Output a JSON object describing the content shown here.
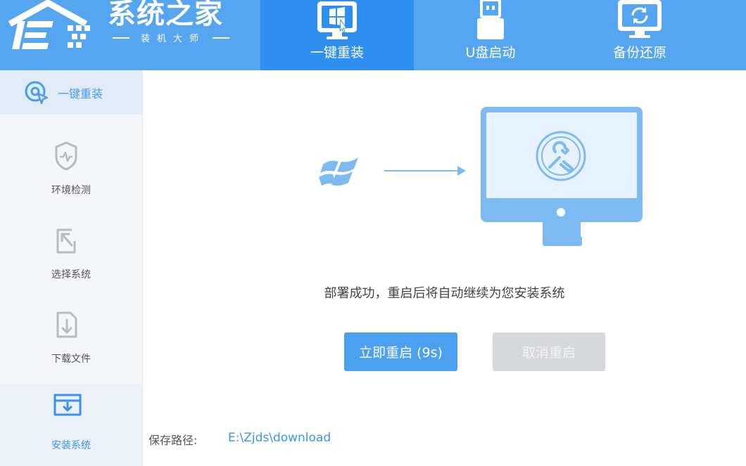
{
  "colors": {
    "header_bg": "#56a5f0",
    "active_tab_bg": "#2f8ff0",
    "primary_button": "#4ca0f0",
    "disabled_button": "#d6d8db",
    "accent_text": "#3b95e8"
  },
  "logo": {
    "title": "系统之家",
    "subtitle": "装机大师",
    "icon": "house-logo-icon"
  },
  "nav": {
    "tabs": [
      {
        "label": "一键重装",
        "icon": "monitor-windows-icon",
        "active": true
      },
      {
        "label": "U盘启动",
        "icon": "usb-drive-icon",
        "active": false
      },
      {
        "label": "备份还原",
        "icon": "backup-restore-icon",
        "active": false
      }
    ]
  },
  "sidebar": {
    "header": {
      "label": "一键重装",
      "icon": "reinstall-cursor-icon"
    },
    "steps": [
      {
        "label": "环境检测",
        "icon": "shield-pulse-icon",
        "active": false
      },
      {
        "label": "选择系统",
        "icon": "select-arrow-icon",
        "active": false
      },
      {
        "label": "下载文件",
        "icon": "file-download-icon",
        "active": false
      },
      {
        "label": "安装系统",
        "icon": "install-box-icon",
        "active": true
      }
    ]
  },
  "main": {
    "illustration": {
      "source_icon": "windows-logo-icon",
      "arrow_icon": "right-arrow-icon",
      "target_icon": "monitor-tools-icon"
    },
    "status_message": "部署成功，重启后将自动继续为您安装系统",
    "restart_button": "立即重启 (9s)",
    "cancel_button": "取消重启",
    "save_path_label": "保存路径:",
    "save_path_value": "E:\\Zjds\\download"
  }
}
